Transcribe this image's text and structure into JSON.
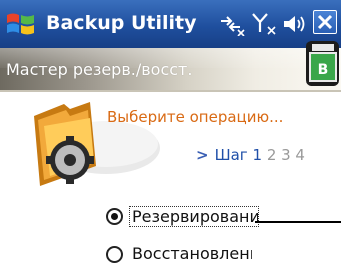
{
  "window": {
    "app_title": "Backup Utility",
    "start_icon": "windows-flag-icon",
    "status_icons": [
      "connectivity-icon",
      "signal-off-icon",
      "volume-icon"
    ],
    "close_icon": "close-icon"
  },
  "header": {
    "title": "Мастер резерв./восст.",
    "icon": "backup-card-icon"
  },
  "main": {
    "illustration_icon": "folder-gear-icon",
    "prompt": "Выберите операцию...",
    "steps": {
      "arrow": ">",
      "label": "Шаг",
      "current": "1",
      "others": "2 3 4"
    },
    "options": [
      {
        "label": "Резервирование",
        "selected": true
      },
      {
        "label": "Восстановление",
        "selected": false
      }
    ]
  },
  "colors": {
    "titlebar": "#1f4f9e",
    "prompt": "#d96a14",
    "step_link": "#1f4fa8"
  }
}
